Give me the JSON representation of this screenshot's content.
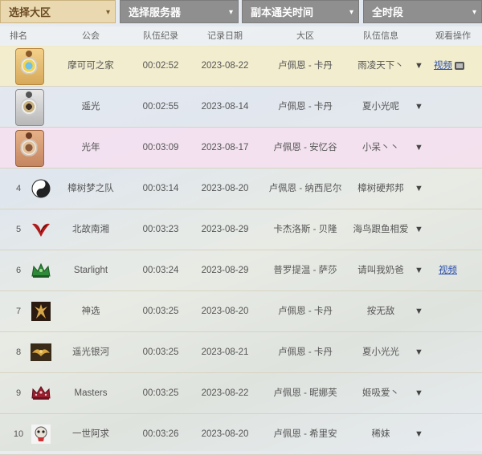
{
  "filters": [
    {
      "label": "选择大区",
      "active": true
    },
    {
      "label": "选择服务器",
      "active": false
    },
    {
      "label": "副本通关时间",
      "active": false
    },
    {
      "label": "全时段",
      "active": false
    }
  ],
  "headers": {
    "rank": "排名",
    "guild": "公会",
    "time": "队伍纪录",
    "date": "记录日期",
    "region": "大区",
    "team": "队伍信息",
    "watch": "观看操作"
  },
  "rows": [
    {
      "rank": "",
      "badge": "gold-medal-icon",
      "guild": "摩可可之家",
      "time": "00:02:52",
      "date": "2023-08-22",
      "region": "卢佩恩 - 卡丹",
      "team": "雨凌天下丶",
      "video": "视频"
    },
    {
      "rank": "",
      "badge": "silver-medal-icon",
      "guild": "遥光",
      "time": "00:02:55",
      "date": "2023-08-14",
      "region": "卢佩恩 - 卡丹",
      "team": "夏小光呢",
      "video": ""
    },
    {
      "rank": "",
      "badge": "bronze-medal-icon",
      "guild": "光年",
      "time": "00:03:09",
      "date": "2023-08-17",
      "region": "卢佩恩 - 安忆谷",
      "team": "小呆丶丶",
      "video": ""
    },
    {
      "rank": "4",
      "badge": "yin-yang-icon",
      "guild": "樟树梦之队",
      "time": "00:03:14",
      "date": "2023-08-20",
      "region": "卢佩恩 - 纳西尼尔",
      "team": "樟树硬邦邦",
      "video": ""
    },
    {
      "rank": "5",
      "badge": "red-wing-icon",
      "guild": "北故南湘",
      "time": "00:03:23",
      "date": "2023-08-29",
      "region": "卡杰洛斯 - 贝隆",
      "team": "海鸟跟鱼相爱",
      "video": ""
    },
    {
      "rank": "6",
      "badge": "green-crown-icon",
      "guild": "Starlight",
      "time": "00:03:24",
      "date": "2023-08-29",
      "region": "普罗提温 - 萨莎",
      "team": "请叫我奶爸",
      "video": "视频"
    },
    {
      "rank": "7",
      "badge": "gold-figure-icon",
      "guild": "神选",
      "time": "00:03:25",
      "date": "2023-08-20",
      "region": "卢佩恩 - 卡丹",
      "team": "按无敌",
      "video": ""
    },
    {
      "rank": "8",
      "badge": "gold-bird-icon",
      "guild": "遥光银河",
      "time": "00:03:25",
      "date": "2023-08-21",
      "region": "卢佩恩 - 卡丹",
      "team": "夏小光光",
      "video": ""
    },
    {
      "rank": "9",
      "badge": "crimson-crown-icon",
      "guild": "Masters",
      "time": "00:03:25",
      "date": "2023-08-22",
      "region": "卢佩恩 - 昵娜芙",
      "team": "姬吸爱丶",
      "video": ""
    },
    {
      "rank": "10",
      "badge": "skull-face-icon",
      "guild": "一世阿求",
      "time": "00:03:26",
      "date": "2023-08-20",
      "region": "卢佩恩 - 希里安",
      "team": "稀妹",
      "video": ""
    }
  ],
  "colors": {
    "accent_filter": "#ead9b0",
    "filter_gray": "#8f8f8f",
    "row1_bg": "#f5edc8",
    "row3_bg": "#f6dff0",
    "link": "#2a4ea8"
  },
  "icons": {
    "expand": "▼",
    "tv": "tv-icon",
    "caret": "▾"
  }
}
